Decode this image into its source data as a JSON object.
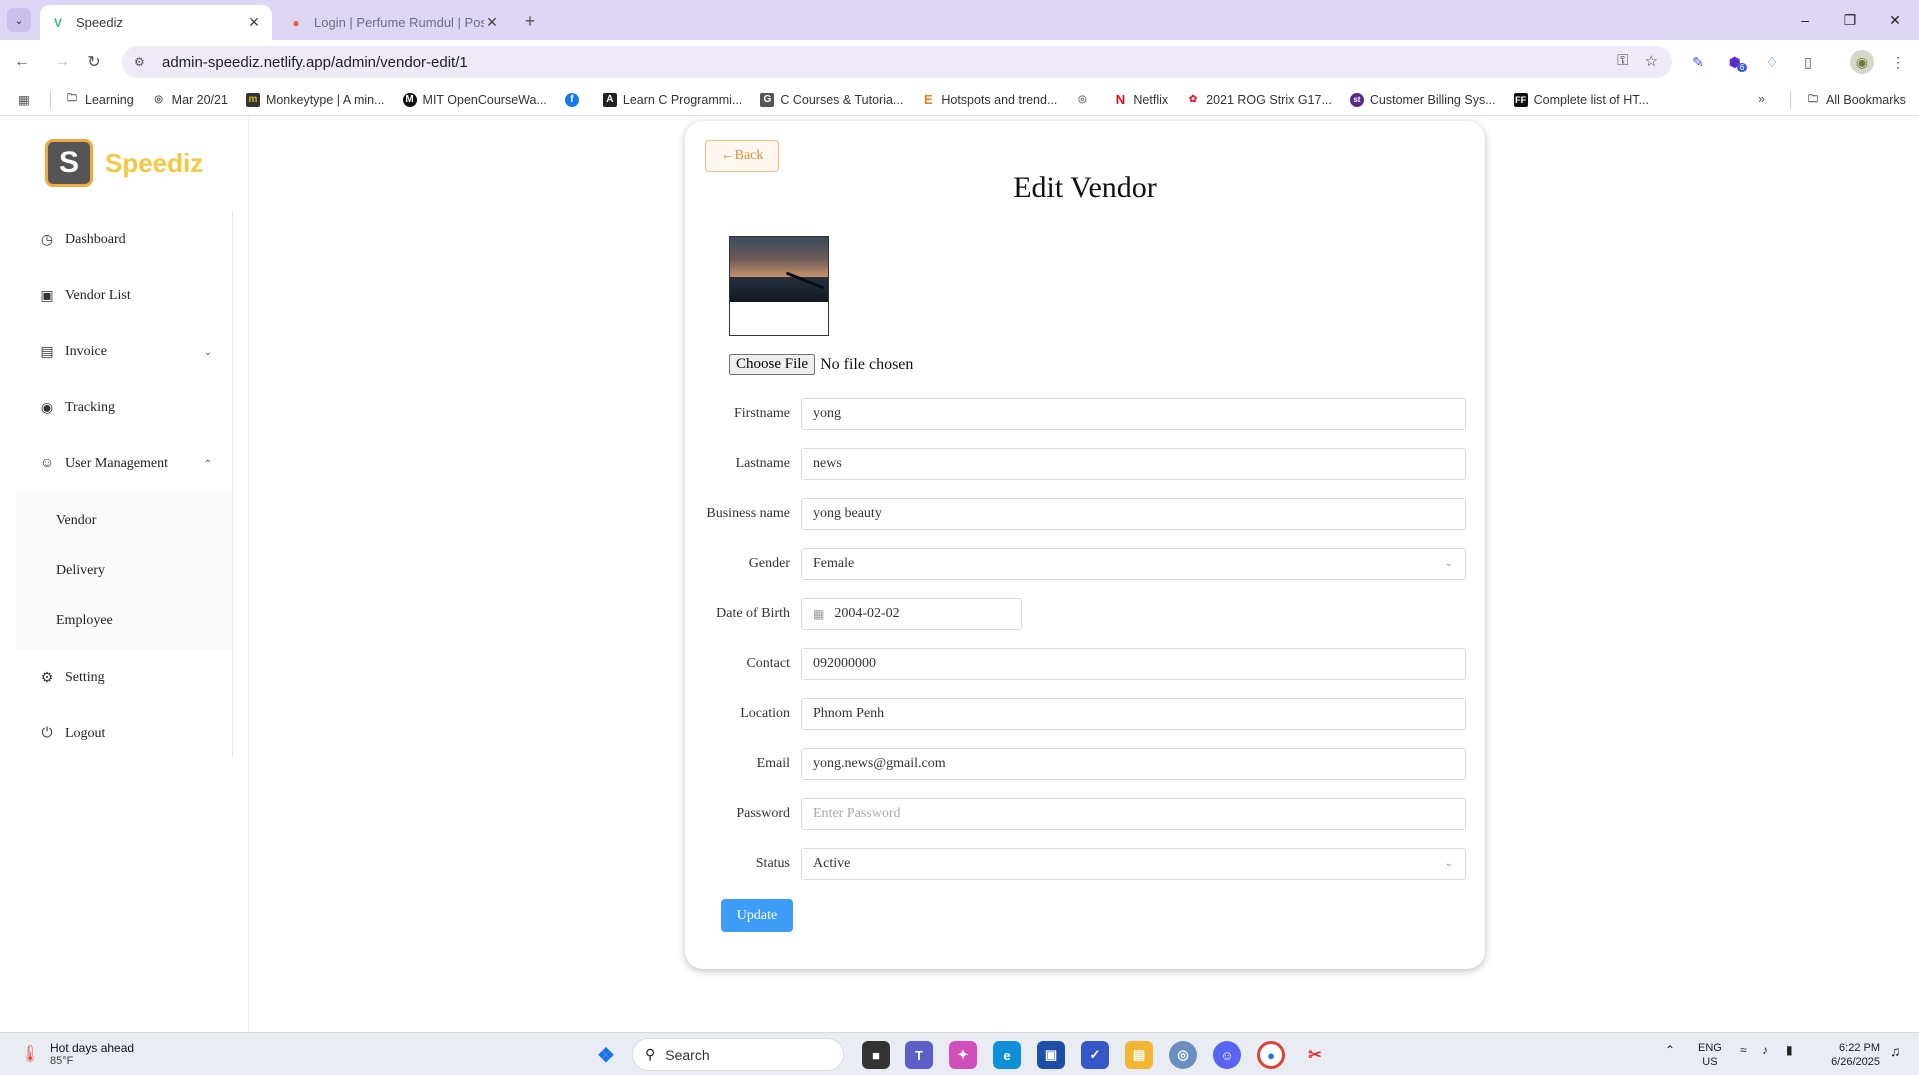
{
  "browser": {
    "tabs": [
      {
        "title": "Speediz",
        "active": true
      },
      {
        "title": "Login | Perfume Rumdul | Postm",
        "active": false
      }
    ],
    "url": "admin-speediz.netlify.app/admin/vendor-edit/1",
    "extension_badge": "6",
    "bookmarks": [
      {
        "label": "Learning",
        "icon": "folder-icon"
      },
      {
        "label": "Mar 20/21",
        "icon": "globe-icon"
      },
      {
        "label": "Monkeytype | A min...",
        "icon": "monkeytype-icon"
      },
      {
        "label": "MIT OpenCourseWa...",
        "icon": "mit-icon"
      },
      {
        "label": "",
        "icon": "facebook-icon"
      },
      {
        "label": "Learn C Programmi...",
        "icon": "learnc-icon"
      },
      {
        "label": "C Courses & Tutoria...",
        "icon": "courses-icon"
      },
      {
        "label": "Hotspots and trend...",
        "icon": "hotspots-icon"
      },
      {
        "label": "",
        "icon": "globe-icon"
      },
      {
        "label": "Netflix",
        "icon": "netflix-icon"
      },
      {
        "label": "2021 ROG Strix G17...",
        "icon": "rog-icon"
      },
      {
        "label": "Customer Billing Sys...",
        "icon": "billing-icon"
      },
      {
        "label": "Complete list of HT...",
        "icon": "ff-icon"
      }
    ],
    "all_bookmarks": "All Bookmarks"
  },
  "app": {
    "logo_letter": "S",
    "brand": "Speediz",
    "menu": {
      "dashboard": "Dashboard",
      "vendor_list": "Vendor List",
      "invoice": "Invoice",
      "tracking": "Tracking",
      "user_management": "User Management",
      "sub": {
        "vendor": "Vendor",
        "delivery": "Delivery",
        "employee": "Employee"
      },
      "setting": "Setting",
      "logout": "Logout"
    }
  },
  "form": {
    "back_label": "←Back",
    "title": "Edit Vendor",
    "choose_file": "Choose File",
    "no_file": "No file chosen",
    "labels": {
      "firstname": "Firstname",
      "lastname": "Lastname",
      "business_name": "Business name",
      "gender": "Gender",
      "dob": "Date of Birth",
      "contact": "Contact",
      "location": "Location",
      "email": "Email",
      "password": "Password",
      "status": "Status"
    },
    "values": {
      "firstname": "yong",
      "lastname": "news",
      "business_name": "yong beauty",
      "gender": "Female",
      "dob": "2004-02-02",
      "contact": "092000000",
      "location": "Phnom Penh",
      "email": "yong.news@gmail.com",
      "password_placeholder": "Enter Password",
      "status": "Active"
    },
    "update_label": "Update"
  },
  "taskbar": {
    "weather_title": "Hot days ahead",
    "weather_temp": "85°F",
    "search": "Search",
    "lang_line1": "ENG",
    "lang_line2": "US",
    "time": "6:22 PM",
    "date": "6/26/2025"
  },
  "colors": {
    "accent": "#3d9cf5",
    "brand": "#f5c842",
    "chrome": "#ddd6f5"
  }
}
